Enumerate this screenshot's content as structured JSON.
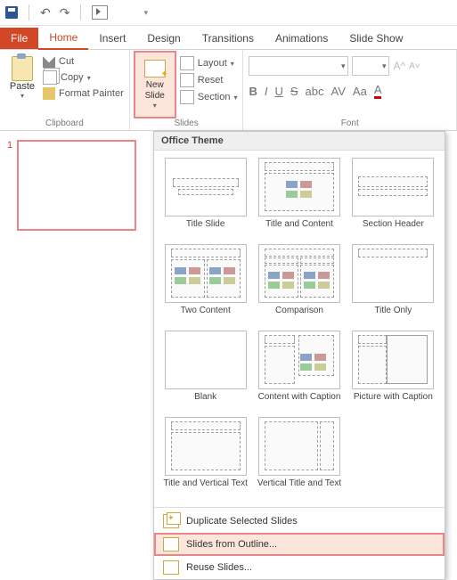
{
  "qat": {
    "save": "save",
    "undo": "↶",
    "redo": "↷"
  },
  "tabs": {
    "file": "File",
    "home": "Home",
    "insert": "Insert",
    "design": "Design",
    "transitions": "Transitions",
    "animations": "Animations",
    "slideshow": "Slide Show"
  },
  "ribbon": {
    "paste": "Paste",
    "cut": "Cut",
    "copy": "Copy",
    "format_painter": "Format Painter",
    "clipboard_label": "Clipboard",
    "new_slide": "New Slide",
    "layout": "Layout",
    "reset": "Reset",
    "section": "Section",
    "slides_label": "Slides",
    "font_label": "Font",
    "bold": "B",
    "italic": "I",
    "underline": "U",
    "strike": "S",
    "charspace": "AV",
    "clear": "Aa",
    "color": "A"
  },
  "thumb": {
    "num": "1"
  },
  "dropdown": {
    "header": "Office Theme",
    "layouts": [
      "Title Slide",
      "Title and Content",
      "Section Header",
      "Two Content",
      "Comparison",
      "Title Only",
      "Blank",
      "Content with Caption",
      "Picture with Caption",
      "Title and Vertical Text",
      "Vertical Title and Text"
    ],
    "dup": "Duplicate Selected Slides",
    "outline": "Slides from Outline...",
    "reuse": "Reuse Slides..."
  }
}
